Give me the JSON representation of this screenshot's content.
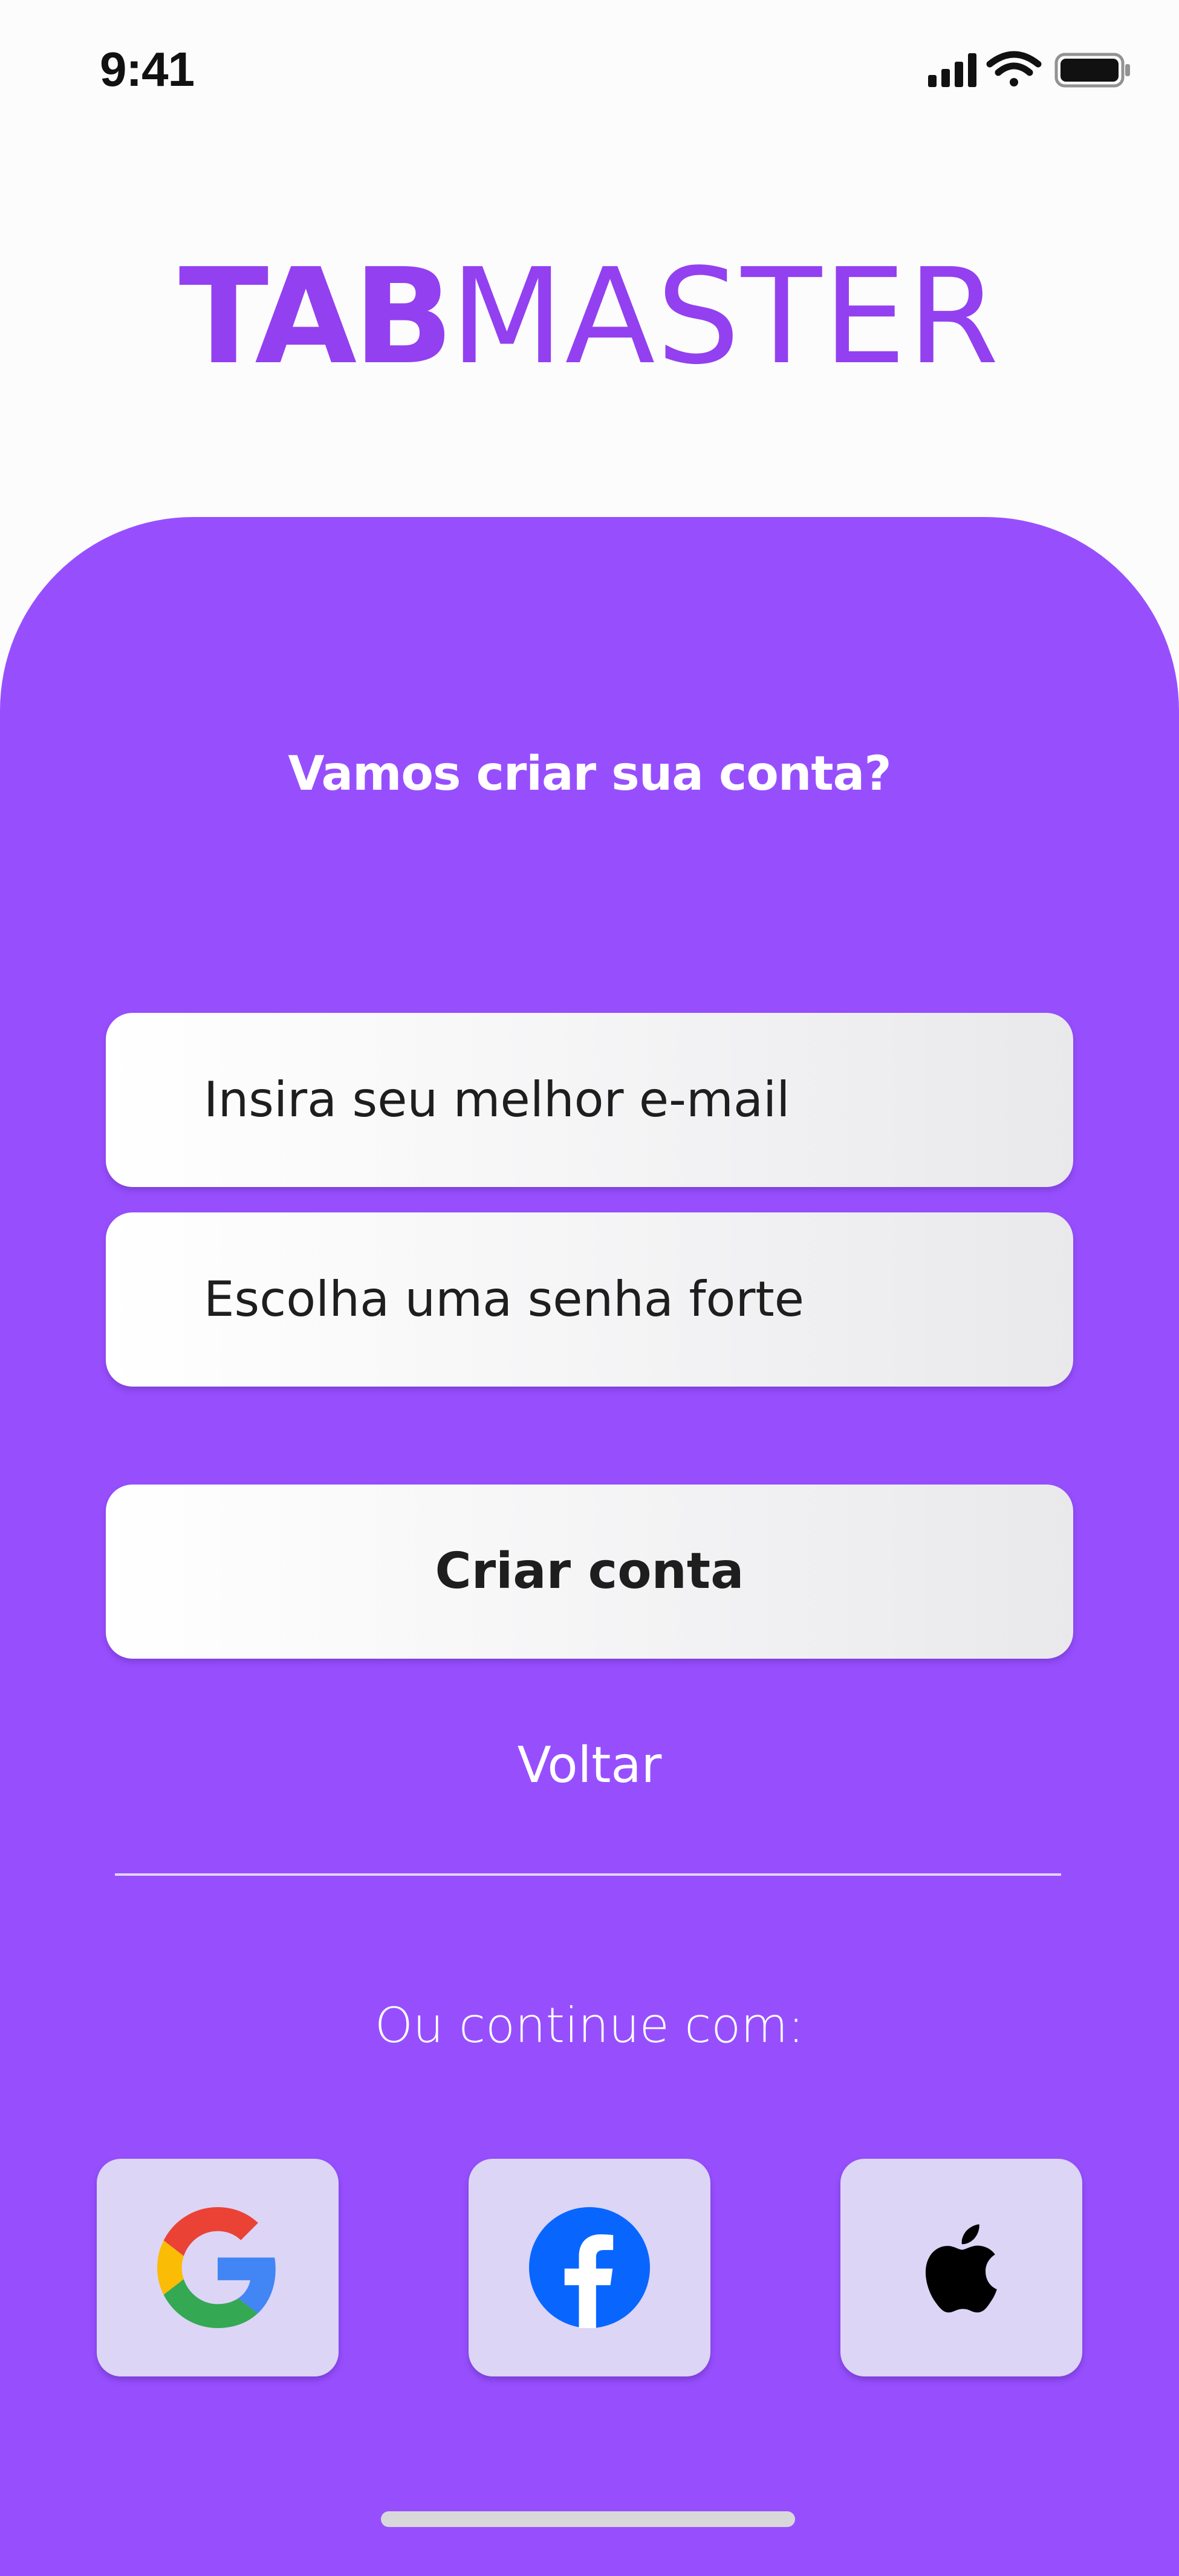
{
  "status_bar": {
    "time": "9:41"
  },
  "logo": {
    "bold_part": "TAB",
    "light_part": "MASTER",
    "color": "#9340f0"
  },
  "panel": {
    "background_color": "#974ffe",
    "heading": "Vamos criar sua conta?"
  },
  "form": {
    "email_placeholder": "Insira seu melhor e-mail",
    "password_placeholder": "Escolha uma senha forte",
    "submit_label": "Criar conta",
    "back_label": "Voltar"
  },
  "social": {
    "label": "Ou continue com:",
    "providers": [
      {
        "name": "Google",
        "icon": "google-icon"
      },
      {
        "name": "Facebook",
        "icon": "facebook-icon"
      },
      {
        "name": "Apple",
        "icon": "apple-icon"
      }
    ],
    "button_background": "#dcd5f6"
  }
}
